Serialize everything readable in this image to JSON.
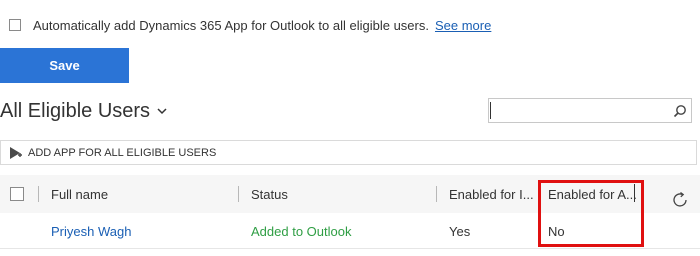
{
  "settings": {
    "auto_add_label": "Automatically add Dynamics 365 App for Outlook to all eligible users.",
    "see_more_link": "See more",
    "save_label": "Save"
  },
  "view": {
    "title": "All Eligible Users",
    "search_value": ""
  },
  "command_bar": {
    "add_app_label": "ADD APP FOR ALL ELIGIBLE USERS"
  },
  "grid": {
    "columns": [
      "Full name",
      "Status",
      "Enabled for I...",
      "Enabled for A..."
    ],
    "rows": [
      {
        "full_name": "Priyesh Wagh",
        "status": "Added to Outlook",
        "enabled_i": "Yes",
        "enabled_a": "No"
      }
    ]
  },
  "colors": {
    "accent": "#2b74d6",
    "link": "#1a5fb4",
    "status_ok": "#2f9e44",
    "highlight": "#e01010"
  }
}
